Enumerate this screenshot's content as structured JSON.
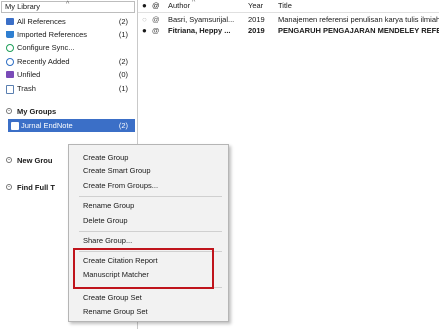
{
  "sidebar": {
    "header": "My Library",
    "items": [
      {
        "label": "All References",
        "count": "(2)"
      },
      {
        "label": "Imported References",
        "count": "(1)"
      },
      {
        "label": "Configure Sync...",
        "count": ""
      },
      {
        "label": "Recently Added",
        "count": "(2)"
      },
      {
        "label": "Unfiled",
        "count": "(0)"
      },
      {
        "label": "Trash",
        "count": "(1)"
      }
    ],
    "my_groups": "My Groups",
    "selected_group": {
      "label": "Jurnal EndNote",
      "count": "(2)"
    },
    "new_group": "New Grou",
    "find_full": "Find Full T"
  },
  "columns": {
    "author": "Author",
    "year": "Year",
    "title": "Title"
  },
  "rows": [
    {
      "author": "Basri, Syamsurijal...",
      "year": "2019",
      "title": "Manajemen referensi penulisan karya tulis ilmiah"
    },
    {
      "author": "Fitriana, Heppy ...",
      "year": "2019",
      "title": "PENGARUH PENGAJARAN MENDELEY REFERENCE"
    }
  ],
  "menu": {
    "create_group": "Create Group",
    "create_smart_group": "Create Smart Group",
    "create_from_groups": "Create From Groups...",
    "rename_group": "Rename Group",
    "delete_group": "Delete Group",
    "share_group": "Share Group...",
    "create_citation_report": "Create Citation Report",
    "manuscript_matcher": "Manuscript Matcher",
    "create_group_set": "Create Group Set",
    "rename_group_set": "Rename Group Set"
  },
  "colors": {
    "selection": "#3b6fc7",
    "highlight": "#c0141c"
  }
}
